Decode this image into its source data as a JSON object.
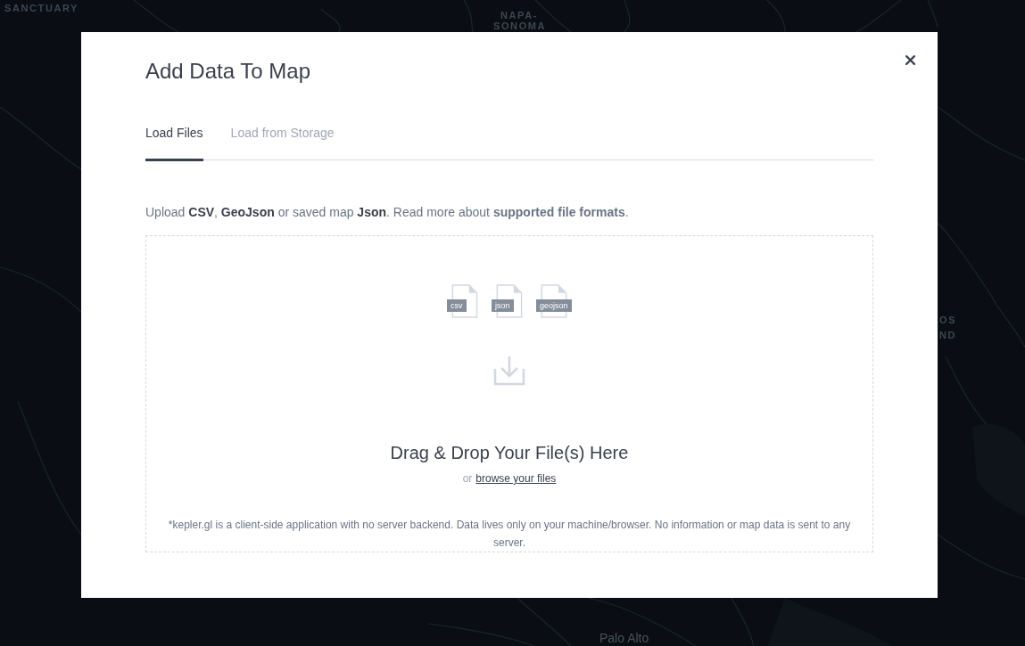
{
  "map": {
    "labels": [
      {
        "text": "SANCTUARY",
        "kind": "region"
      },
      {
        "text": "NAPA-",
        "kind": "region"
      },
      {
        "text": "SONOMA",
        "kind": "region"
      },
      {
        "text": "OS",
        "kind": "region"
      },
      {
        "text": "ND",
        "kind": "region"
      },
      {
        "text": "Palo Alto",
        "kind": "city"
      }
    ]
  },
  "modal": {
    "title": "Add Data To Map"
  },
  "tabs": [
    {
      "label": "Load Files",
      "selected": true
    },
    {
      "label": "Load from Storage",
      "selected": false
    }
  ],
  "upload_instructions": {
    "text": "Upload **CSV**, **GeoJson** or saved map **Json**. Read more about",
    "link": "supported file formats",
    "end": "."
  },
  "drop_zone": {
    "file_types": [
      "csv",
      "json",
      "geojson"
    ],
    "heading": "Drag & Drop Your File(s) Here",
    "or_text": "or",
    "browse_link": "browse your files",
    "disclaimer": "*kepler.gl is a client-side application with no server backend. Data lives only on your machine/browser. No information or map data is sent to any server."
  }
}
